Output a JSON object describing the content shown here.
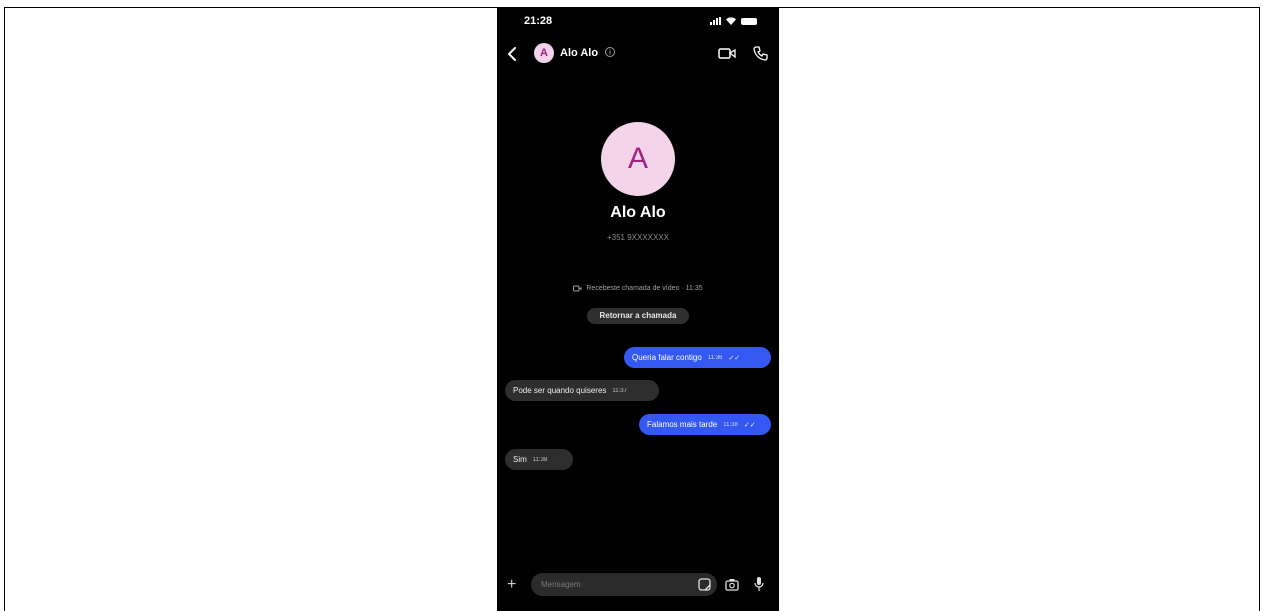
{
  "status_bar": {
    "time": "21:28"
  },
  "header": {
    "avatar_letter": "A",
    "contact_name": "Alo Alo"
  },
  "profile": {
    "avatar_letter": "A",
    "name": "Alo Alo",
    "subtitle": "+351 9XXXXXXX"
  },
  "missed_call": {
    "text": "Recebeste chamada de vídeo · 11:35",
    "button_label": "Retornar a chamada"
  },
  "messages": [
    {
      "direction": "out",
      "text": "Queria falar contigo",
      "time": "11:36"
    },
    {
      "direction": "in",
      "text": "Pode ser quando quiseres",
      "time": "11:37"
    },
    {
      "direction": "out",
      "text": "Falamos mais tarde",
      "time": "11:38"
    },
    {
      "direction": "in",
      "text": "Sim",
      "time": "11:38"
    }
  ],
  "composer": {
    "placeholder": "Mensagem"
  },
  "colors": {
    "background": "#000000",
    "outgoing_bubble": "#3558f2",
    "incoming_bubble": "#2e2e2e",
    "avatar_bg": "#f4d4ea",
    "avatar_letter": "#a3227f"
  },
  "icons": [
    "back-icon",
    "info-icon",
    "video-call-icon",
    "phone-icon",
    "missed-video-call-icon",
    "plus-icon",
    "sticker-icon",
    "camera-icon",
    "mic-icon"
  ]
}
